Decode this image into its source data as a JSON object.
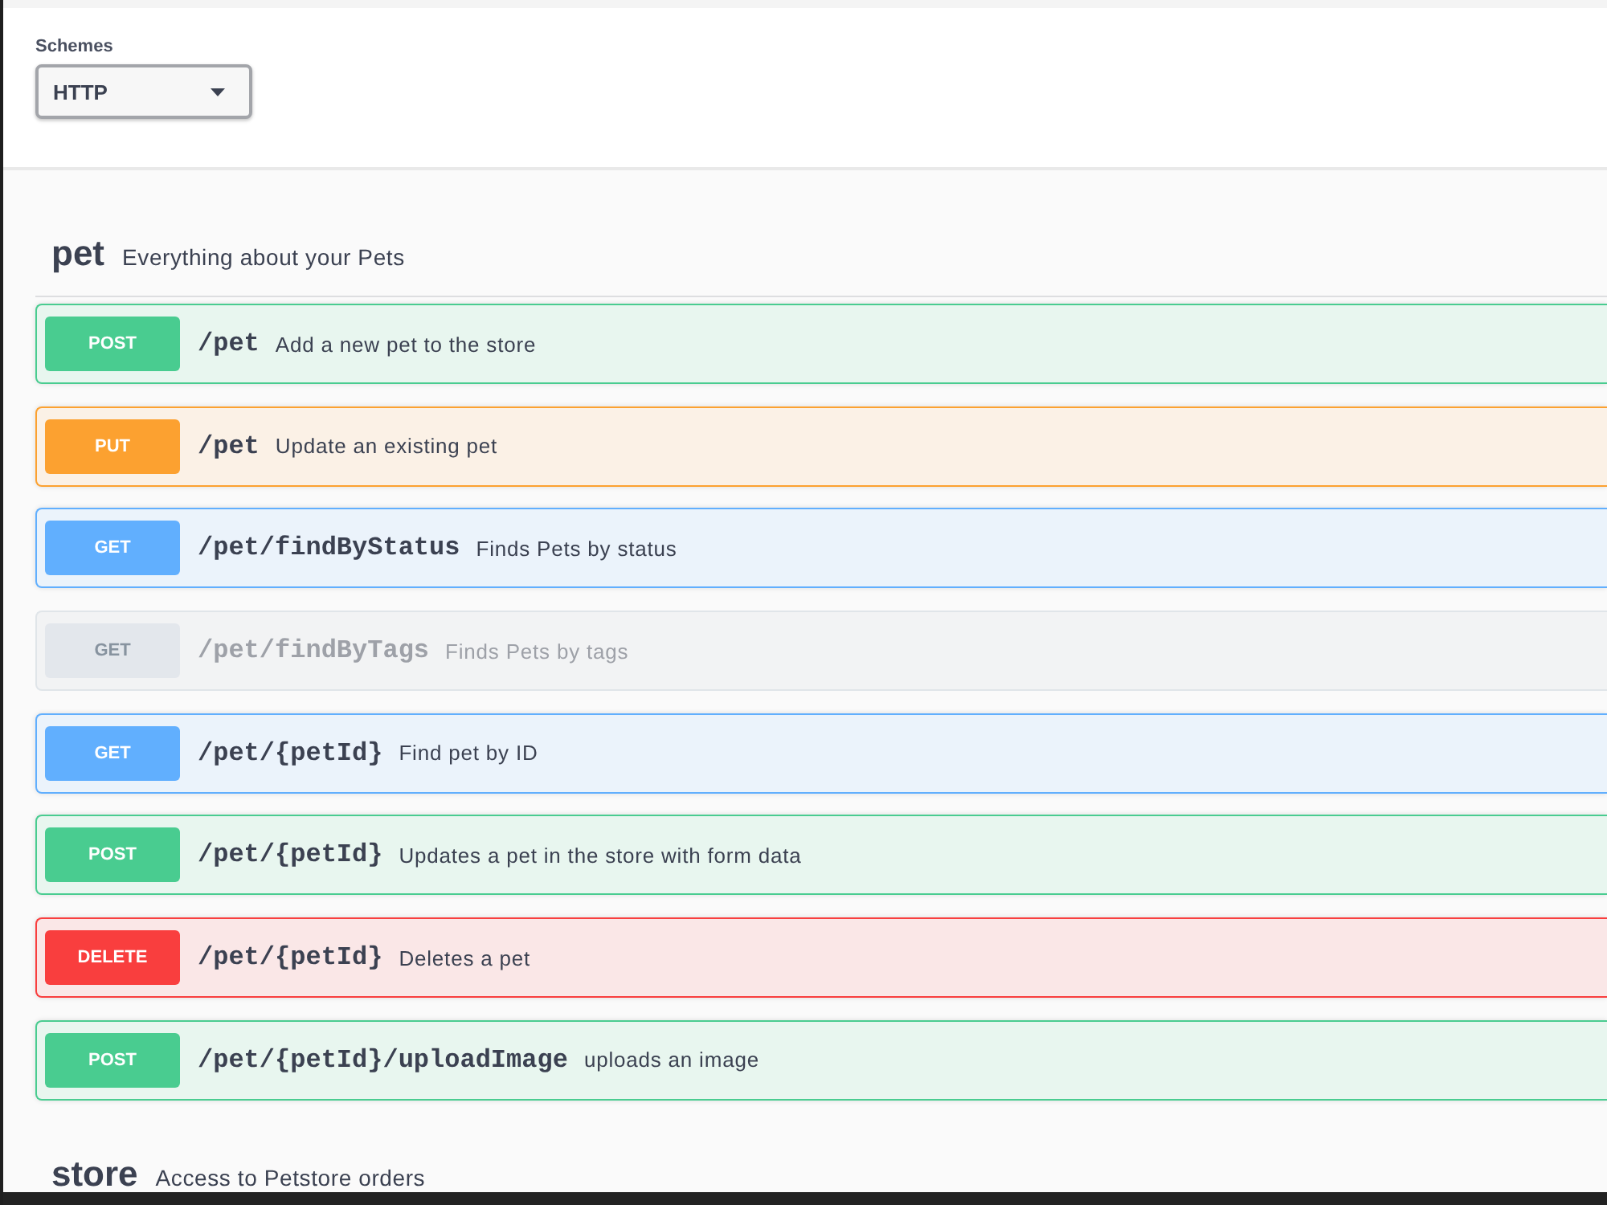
{
  "schemes": {
    "label": "Schemes",
    "value": "HTTP"
  },
  "tags": [
    {
      "name": "pet",
      "description": "Everything about your Pets",
      "operations": [
        {
          "kind": "post",
          "method": "POST",
          "path": "/pet",
          "summary": "Add a new pet to the store",
          "deprecated": false
        },
        {
          "kind": "put",
          "method": "PUT",
          "path": "/pet",
          "summary": "Update an existing pet",
          "deprecated": false
        },
        {
          "kind": "get",
          "method": "GET",
          "path": "/pet/findByStatus",
          "summary": "Finds Pets by status",
          "deprecated": false
        },
        {
          "kind": "get",
          "method": "GET",
          "path": "/pet/findByTags",
          "summary": "Finds Pets by tags",
          "deprecated": true
        },
        {
          "kind": "get",
          "method": "GET",
          "path": "/pet/{petId}",
          "summary": "Find pet by ID",
          "deprecated": false
        },
        {
          "kind": "post",
          "method": "POST",
          "path": "/pet/{petId}",
          "summary": "Updates a pet in the store with form data",
          "deprecated": false
        },
        {
          "kind": "delete",
          "method": "DELETE",
          "path": "/pet/{petId}",
          "summary": "Deletes a pet",
          "deprecated": false
        },
        {
          "kind": "post",
          "method": "POST",
          "path": "/pet/{petId}/uploadImage",
          "summary": "uploads an image",
          "deprecated": false
        }
      ]
    },
    {
      "name": "store",
      "description": "Access to Petstore orders"
    }
  ]
}
